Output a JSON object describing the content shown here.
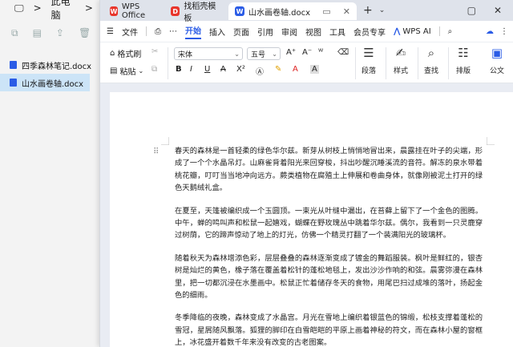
{
  "explorer": {
    "path": [
      "此电脑",
      ">",
      "新"
    ],
    "files": [
      {
        "name": "四季森林笔记.docx",
        "selected": false
      },
      {
        "name": "山水画卷轴.docx",
        "selected": true
      }
    ]
  },
  "tabs": [
    {
      "label": "WPS Office",
      "color": "#e8352b",
      "glyph": "W"
    },
    {
      "label": "找稻壳模板",
      "color": "#e8352b",
      "glyph": "D"
    },
    {
      "label": "山水画卷轴.docx",
      "color": "#2b5ce6",
      "glyph": "W",
      "active": true
    }
  ],
  "menu": {
    "file": "文件",
    "items": [
      "开始",
      "插入",
      "页面",
      "引用",
      "审阅",
      "视图",
      "工具",
      "会员专享"
    ],
    "active": "开始",
    "wps_ai": "WPS AI"
  },
  "ribbon": {
    "format_painter": "格式刷",
    "paste": "粘贴",
    "font": "宋体",
    "size": "五号",
    "paragraph": "段落",
    "style": "样式",
    "find": "查找",
    "layout": "排版",
    "formula": "公文"
  },
  "document": {
    "paragraphs": [
      "春天的森林是一首轻柔的绿色华尔兹。新芽从树枝上悄悄地冒出来，晨露挂在叶子的尖端，形成了一个个水晶吊灯。山麻雀背着阳光来回穿梭，抖出吵醒沉睡溪流的音符。解冻的泉水带着桃花瓣，叮叮当当地冲向远方。蕨类植物在腐殖土上伸展和卷曲身体，就像刚被泥土打开的绿色天鹅绒礼盒。",
      "在夏至，天篷被编织成一个玉圆顶。一束光从叶缝中漏出，在苔藓上留下了一个金色的图腾。中午，蝉的鸣叫声和松鼠一起嬉戏，蝴蝶在野玫瑰丛中跳着华尔兹。偶尔，我看到一只灵鹿穿过树荫，它的蹄声惊动了地上的灯光，仿佛一个精灵打翻了一个装满阳光的玻璃杯。",
      "随着秋天为森林增添色彩，层层叠叠的森林逐渐变成了镀金的舞蹈服装。枫叶是鲜红的，银杏树是灿烂的黄色，橡子落在覆盖着松针的蓬松地毯上，发出沙沙作响的和弦。晨雾弥漫在森林里，把一切都沉浸在水墨画中。松鼠正忙着储存冬天的食物，用尾巴扫过成堆的落叶，扬起金色的细雨。",
      "冬季降临的夜晚，森林变成了水晶宫。月光在雪地上编织着银蓝色的锦缎，松枝支撑着蓬松的雪冠，星屑随风飘落。狐狸的脚印在白雪皑皑的平原上画着神秘的符文，而在森林小屋的窗框上，冰花盛开着数千年来没有改变的古老图案。"
    ]
  }
}
